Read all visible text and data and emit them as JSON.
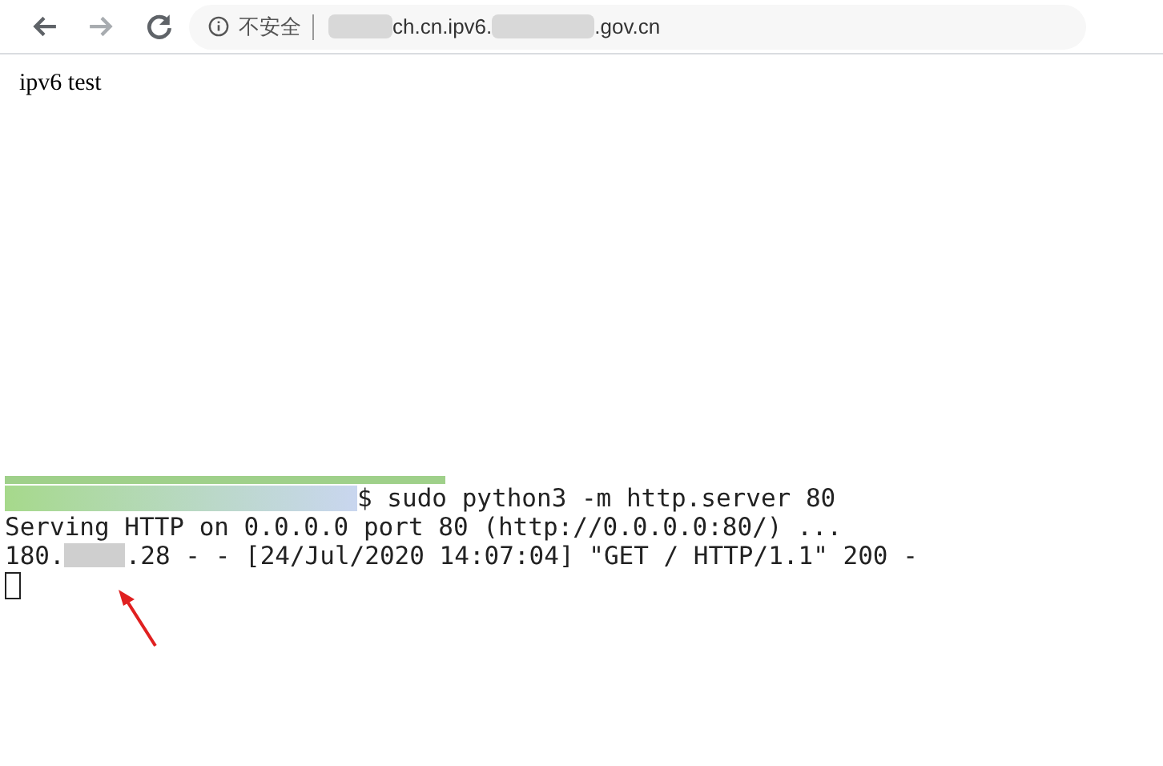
{
  "browser": {
    "security_label": "不安全",
    "url_parts": [
      "ch.cn.ipv6.",
      ".gov.cn"
    ],
    "page_text": "ipv6 test"
  },
  "terminal": {
    "command": "$ sudo python3 -m http.server 80",
    "output": "Serving HTTP on 0.0.0.0 port 80 (http://0.0.0.0:80/) ...",
    "log_prefix": "180.",
    "log_rest": ".28 - - [24/Jul/2020 14:07:04] \"GET / HTTP/1.1\" 200 -"
  }
}
